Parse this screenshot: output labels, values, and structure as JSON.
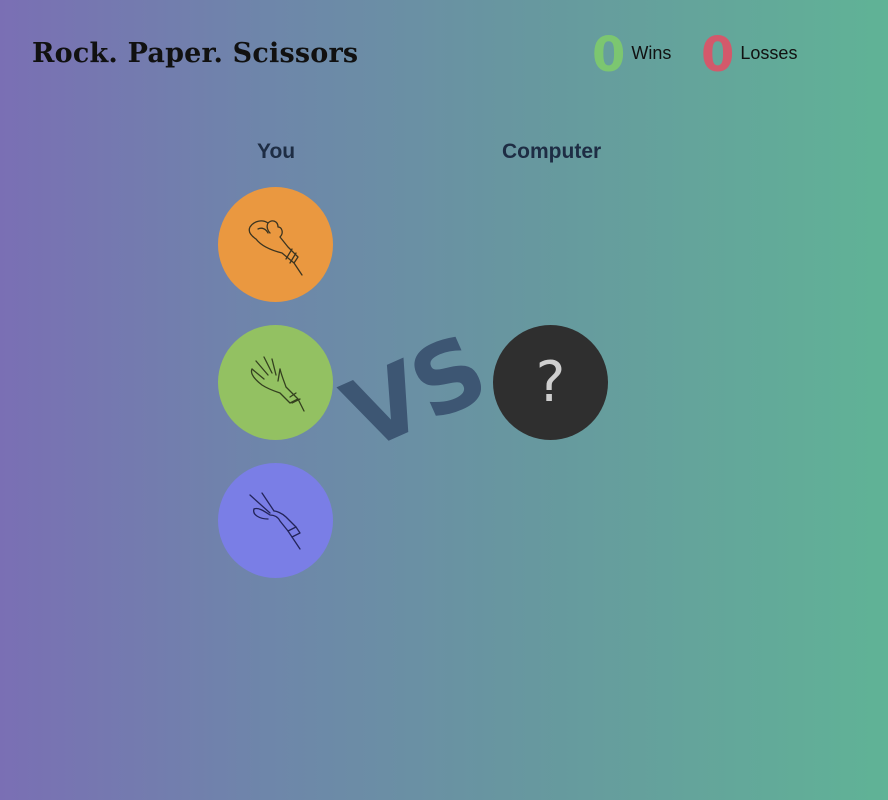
{
  "header": {
    "title": "Rock. Paper. Scissors"
  },
  "score": {
    "wins": {
      "value": "0",
      "label": "Wins",
      "color": "#7cc670"
    },
    "losses": {
      "value": "0",
      "label": "Losses",
      "color": "#d3596b"
    }
  },
  "board": {
    "player_label": "You",
    "computer_label": "Computer",
    "vs_label": "VS",
    "computer_choice": "?",
    "choices": [
      {
        "name": "rock",
        "icon": "rock-hand-icon",
        "color": "#ea9840"
      },
      {
        "name": "paper",
        "icon": "paper-hand-icon",
        "color": "#93c162"
      },
      {
        "name": "scissors",
        "icon": "scissors-hand-icon",
        "color": "#7a7ee6"
      }
    ]
  }
}
